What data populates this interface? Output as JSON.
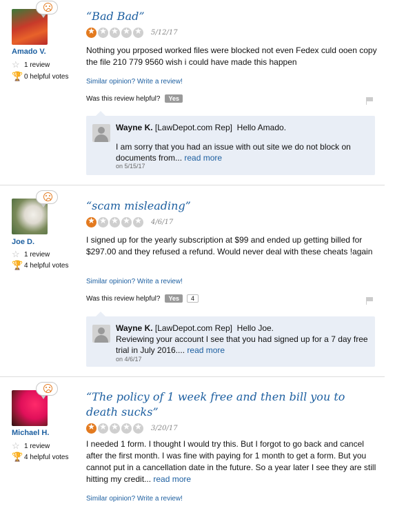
{
  "reviews": [
    {
      "user": "Amado V.",
      "reviews_count": "1 review",
      "helpful_votes": "0 helpful votes",
      "title": "“Bad Bad”",
      "rating": 1,
      "date": "5/12/17",
      "body": "Nothing you prposed worked files were blocked not even Fedex culd ooen copy the file 210 779 9560 wish i could have made this happen",
      "body_more": "",
      "similar": "Similar opinion? Write a review!",
      "helpful_q": "Was this review helpful?",
      "yes": "Yes",
      "vote_count": "",
      "reply": {
        "author": "Wayne K.",
        "role": "[LawDepot.com Rep]",
        "greeting": "Hello Amado.",
        "text": "I am sorry that you had an issue with out site we do not block on documents from...",
        "more": "read more",
        "date": "on 5/15/17"
      }
    },
    {
      "user": "Joe D.",
      "reviews_count": "1 review",
      "helpful_votes": "4 helpful votes",
      "title": "“scam misleading”",
      "rating": 1,
      "date": "4/6/17",
      "body": "I signed up for the yearly subscription at $99 and ended up getting billed for $297.00 and they refused a refund. Would never deal with these cheats !again",
      "body_more": "",
      "similar": "Similar opinion? Write a review!",
      "helpful_q": "Was this review helpful?",
      "yes": "Yes",
      "vote_count": "4",
      "reply": {
        "author": "Wayne K.",
        "role": "[LawDepot.com Rep]",
        "greeting": "Hello Joe.",
        "text": "Reviewing your account I see that you had signed up for a 7 day free trial in July 2016....",
        "more": "read more",
        "date": "on 4/6/17"
      }
    },
    {
      "user": "Michael H.",
      "reviews_count": "1 review",
      "helpful_votes": "4 helpful votes",
      "title": "“The policy of 1 week free and then bill you to death sucks”",
      "rating": 1,
      "date": "3/20/17",
      "body": "I needed 1 form. I thought I would try this. But I forgot to go back and cancel after the first month. I was fine with paying for 1 month to get a form. But you cannot put in a cancellation date in the future. So a year later I see they are still hitting my credit...",
      "body_more": "read more",
      "similar": "Similar opinion? Write a review!"
    }
  ],
  "colors": {
    "link": "#1d5fa0",
    "star_on": "#e37a1f",
    "star_off": "#cfcfcf",
    "reply_bg": "#e9eef6"
  },
  "icons": {
    "helpful": "trophy-icon",
    "reviews": "star-outline-icon",
    "mood": "frown-face-icon",
    "report": "flag-icon"
  }
}
